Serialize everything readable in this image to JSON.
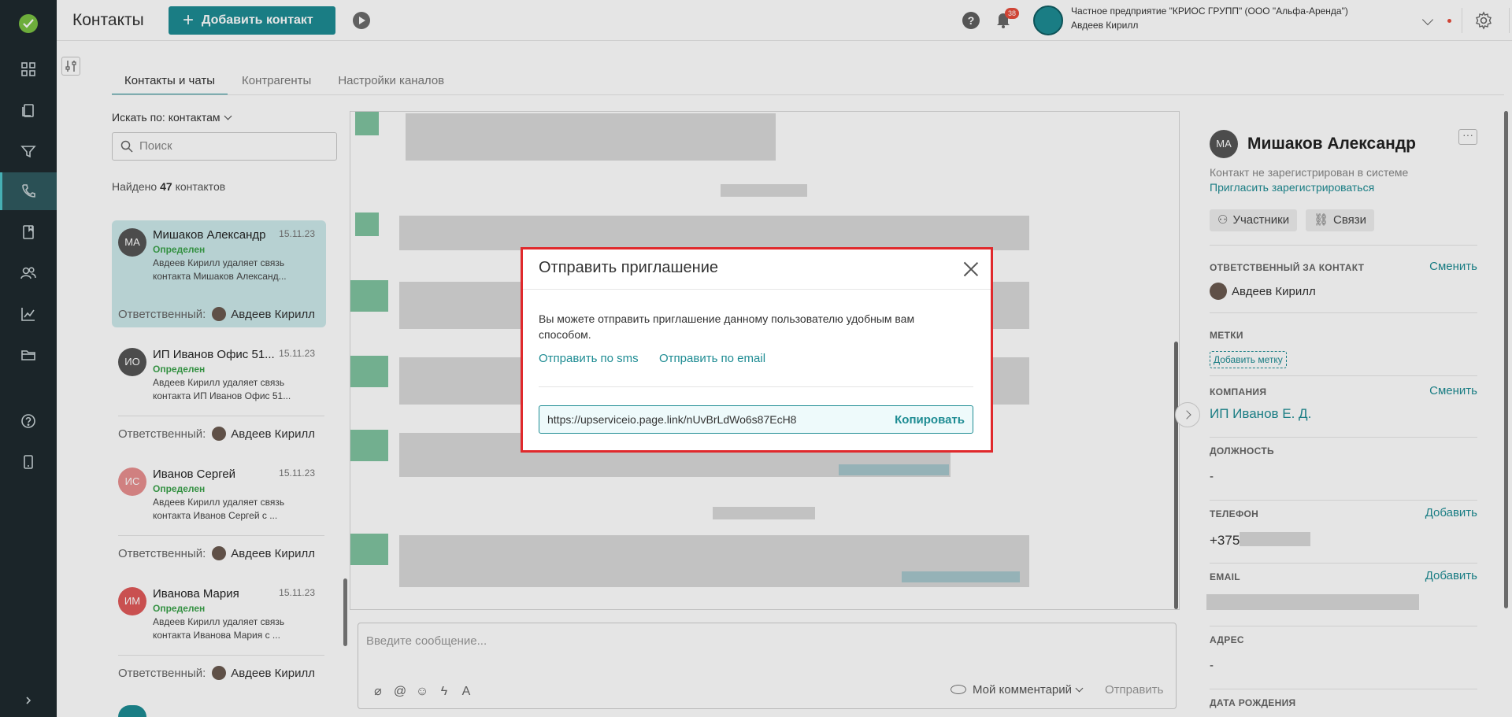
{
  "header": {
    "title": "Контакты",
    "add_button": "Добавить контакт",
    "notifications_count": "38",
    "company_name": "Частное предприятие \"КРИОС ГРУПП\" (ООО \"Альфа-Аренда\")",
    "user_name": "Авдеев Кирилл"
  },
  "tabs": [
    "Контакты и чаты",
    "Контрагенты",
    "Настройки каналов"
  ],
  "contacts_panel": {
    "search_by": "Искать по: контактам",
    "search_placeholder": "Поиск",
    "found_prefix": "Найдено",
    "found_count": "47",
    "found_suffix": "контактов",
    "responsible_label": "Ответственный:",
    "contacts": [
      {
        "initials": "МА",
        "name": "Мишаков Александр",
        "date": "15.11.23",
        "status": "Определен",
        "preview": "Авдеев Кирилл удаляет связь контакта Мишаков Александ...",
        "responsible": "Авдеев Кирилл",
        "avatar_color": "#555555"
      },
      {
        "initials": "ИО",
        "name": "ИП Иванов Офис 51...",
        "date": "15.11.23",
        "status": "Определен",
        "preview": "Авдеев Кирилл удаляет связь контакта ИП Иванов Офис 51...",
        "responsible": "Авдеев Кирилл",
        "avatar_color": "#555555"
      },
      {
        "initials": "ИС",
        "name": "Иванов Сергей",
        "date": "15.11.23",
        "status": "Определен",
        "preview": "Авдеев Кирилл удаляет связь контакта Иванов Сергей с ...",
        "responsible": "Авдеев Кирилл",
        "avatar_color": "#e88f8f"
      },
      {
        "initials": "ИМ",
        "name": "Иванова Мария",
        "date": "15.11.23",
        "status": "Определен",
        "preview": "Авдеев Кирилл удаляет связь контакта Иванова Мария с ...",
        "responsible": "Авдеев Кирилл",
        "avatar_color": "#e05a5a"
      }
    ]
  },
  "composer": {
    "placeholder": "Введите сообщение...",
    "mode_label": "Мой комментарий",
    "send_label": "Отправить"
  },
  "profile": {
    "initials": "МА",
    "name": "Мишаков Александр",
    "more": "···",
    "not_registered": "Контакт не зарегистрирован в системе",
    "invite_link": "Пригласить зарегистрироваться",
    "participants_chip": "Участники",
    "links_chip": "Связи",
    "responsible_label": "ОТВЕТСТВЕННЫЙ ЗА КОНТАКТ",
    "change_label": "Сменить",
    "responsible_name": "Авдеев Кирилл",
    "tags_label": "МЕТКИ",
    "add_tag": "Добавить метку",
    "company_label": "КОМПАНИЯ",
    "company_change": "Сменить",
    "company_value": "ИП Иванов Е. Д.",
    "position_label": "ДОЛЖНОСТЬ",
    "position_value": "-",
    "phone_label": "ТЕЛЕФОН",
    "phone_add": "Добавить",
    "phone_value": "+375",
    "email_label": "EMAIL",
    "email_add": "Добавить",
    "address_label": "АДРЕС",
    "address_value": "-",
    "birthday_label": "ДАТА РОЖДЕНИЯ"
  },
  "modal": {
    "title": "Отправить приглашение",
    "text": "Вы можете отправить приглашение данному пользователю удобным вам способом.",
    "send_sms": "Отправить по sms",
    "send_email": "Отправить по email",
    "url": "https://upserviceio.page.link/nUvBrLdWo6s87EcH8",
    "copy": "Копировать"
  },
  "colors": {
    "accent": "#1e8c93",
    "sidebar": "#1f2a2e",
    "status_green": "#3aa24a",
    "modal_border": "#e0292c"
  }
}
